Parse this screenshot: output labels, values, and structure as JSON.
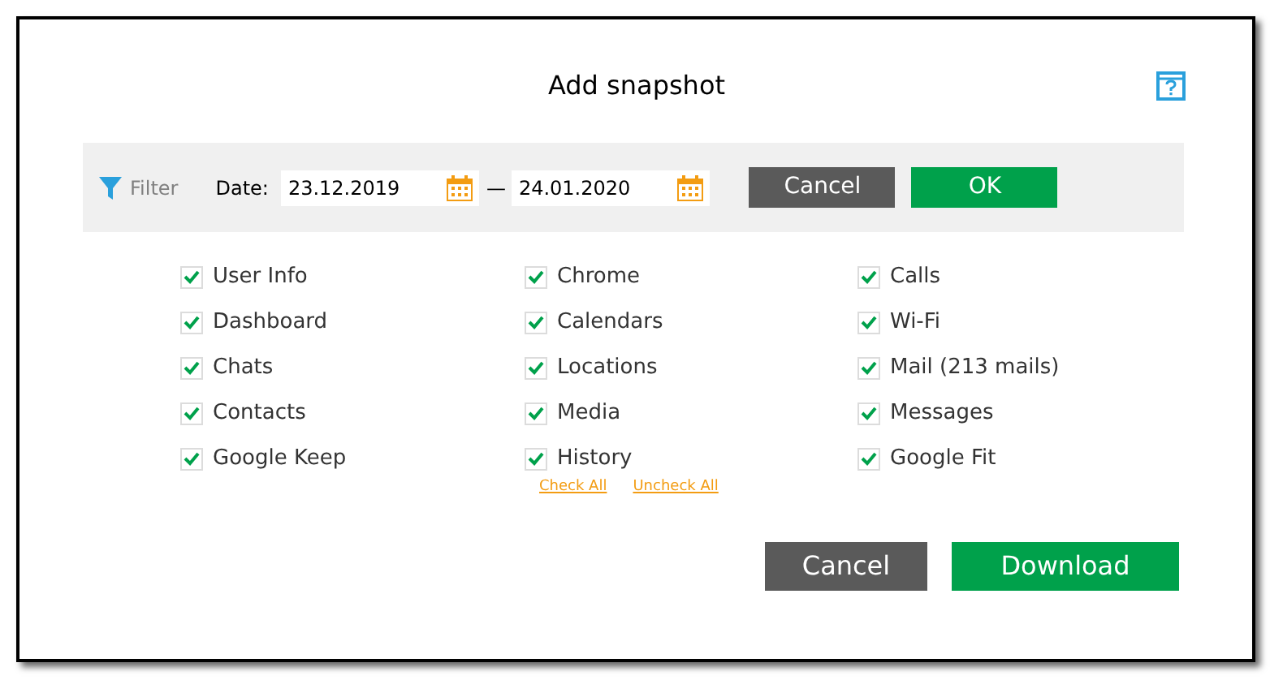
{
  "dialog": {
    "title": "Add snapshot"
  },
  "filter": {
    "label": "Filter",
    "date_label": "Date:",
    "from": "23.12.2019",
    "separator": "—",
    "to": "24.01.2020",
    "buttons": [
      {
        "label": "Cancel",
        "kind": "secondary"
      },
      {
        "label": "OK",
        "kind": "primary"
      }
    ]
  },
  "columns": [
    [
      {
        "label": "User Info",
        "checked": true
      },
      {
        "label": "Dashboard",
        "checked": true
      },
      {
        "label": "Chats",
        "checked": true
      },
      {
        "label": "Contacts",
        "checked": true
      },
      {
        "label": "Google Keep",
        "checked": true
      }
    ],
    [
      {
        "label": "Chrome",
        "checked": true
      },
      {
        "label": "Calendars",
        "checked": true
      },
      {
        "label": "Locations",
        "checked": true
      },
      {
        "label": "Media",
        "checked": true
      },
      {
        "label": "History",
        "checked": true
      }
    ],
    [
      {
        "label": "Calls",
        "checked": true
      },
      {
        "label": "Wi-Fi",
        "checked": true
      },
      {
        "label": "Mail (213 mails)",
        "checked": true
      },
      {
        "label": "Messages",
        "checked": true
      },
      {
        "label": "Google Fit",
        "checked": true
      }
    ]
  ],
  "links": [
    "Check All",
    "Uncheck All"
  ],
  "buttons": [
    {
      "label": "Cancel",
      "kind": "secondary"
    },
    {
      "label": "Download",
      "kind": "primary"
    }
  ]
}
